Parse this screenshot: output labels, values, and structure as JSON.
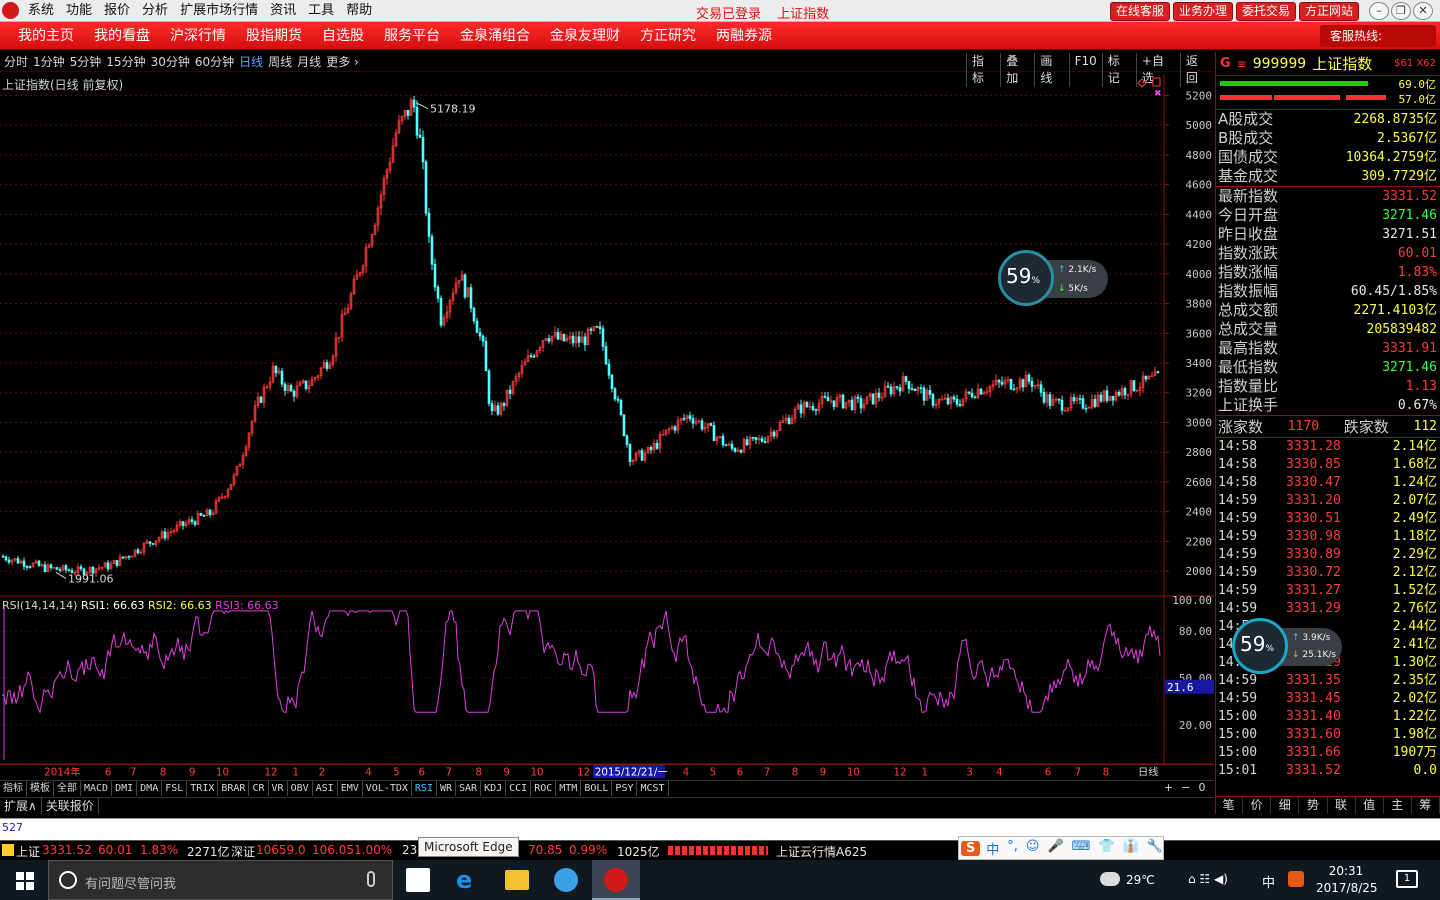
{
  "titlebar": {
    "menu": [
      "系统",
      "功能",
      "报价",
      "分析",
      "扩展市场行情",
      "资讯",
      "工具",
      "帮助"
    ],
    "status": "交易已登录",
    "context": "上证指数",
    "right_buttons": [
      "在线客服",
      "业务办理",
      "委托交易",
      "方正网站"
    ]
  },
  "navbar": {
    "items": [
      "我的主页",
      "我的看盘",
      "沪深行情",
      "股指期货",
      "自选股",
      "服务平台",
      "金泉涌组合",
      "金泉友理财",
      "方正研究",
      "两融券源"
    ],
    "hotline_label": "客服热线:",
    "hotline_number": "95571"
  },
  "periods": [
    "分时",
    "1分钟",
    "5分钟",
    "15分钟",
    "30分钟",
    "60分钟",
    "日线",
    "周线",
    "月线",
    "更多 ›"
  ],
  "selected_period": "日线",
  "chart_tools": [
    "指标",
    "叠加",
    "画线",
    "F10",
    "标记",
    "+自选",
    "返回"
  ],
  "chart_title": "上证指数(日线 前复权)",
  "rsi_header": {
    "name": "RSI(14,14,14)",
    "rsi1": "RSI1: 66.63",
    "rsi2": "RSI2: 66.63",
    "rsi3": "RSI3: 66.63"
  },
  "chart_data": {
    "type": "candlestick",
    "high_label": "5178.19",
    "low_label": "1991.06",
    "y_ticks": [
      "5200",
      "5000",
      "4800",
      "4600",
      "4400",
      "4200",
      "4000",
      "3800",
      "3600",
      "3400",
      "3200",
      "3000",
      "2800",
      "2600",
      "2400",
      "2200",
      "2000"
    ],
    "ylim": [
      1900,
      5250
    ],
    "rsi_ticks": [
      "100.00",
      "80.00",
      "50.00",
      "20.00"
    ],
    "rsi_current": "21.6",
    "date_axis": [
      "2014年",
      "6",
      "7",
      "8",
      "9",
      "10",
      "12",
      "1",
      "2",
      "4",
      "5",
      "6",
      "7",
      "8",
      "9",
      "10",
      "12",
      "2015/12/21/一",
      "4",
      "5",
      "6",
      "7",
      "8",
      "9",
      "10",
      "12",
      "1",
      "3",
      "4",
      "6",
      "7",
      "8"
    ],
    "date_axis_label": "日线",
    "colors": {
      "up": "#ff3c3c",
      "down": "#54ffff",
      "rsi": "#e040e0"
    }
  },
  "indicator_tabs": [
    "指标",
    "模板",
    "全部",
    "MACD",
    "DMI",
    "DMA",
    "FSL",
    "TRIX",
    "BRAR",
    "CR",
    "VR",
    "OBV",
    "ASI",
    "EMV",
    "VOL-TDX",
    "RSI",
    "WR",
    "SAR",
    "KDJ",
    "CCI",
    "ROC",
    "MTM",
    "BOLL",
    "PSY",
    "MCST"
  ],
  "selected_indicator": "RSI",
  "indicator_controls": [
    "+",
    "−",
    "0"
  ],
  "bottom_tabs": [
    "扩展∧",
    "关联报价"
  ],
  "quote": {
    "flag": "G",
    "code": "999999",
    "name": "上证指数",
    "tag": "$61 X62",
    "bar1_label": "69.0亿",
    "bar2_label": "57.0亿",
    "turnover_rows": [
      {
        "k": "A股成交",
        "v": "2268.8735亿"
      },
      {
        "k": "B股成交",
        "v": "2.5367亿"
      },
      {
        "k": "国债成交",
        "v": "10364.2759亿"
      },
      {
        "k": "基金成交",
        "v": "309.7729亿"
      }
    ],
    "index_rows": [
      {
        "k": "最新指数",
        "v": "3331.52",
        "c": "red"
      },
      {
        "k": "今日开盘",
        "v": "3271.46",
        "c": "grn"
      },
      {
        "k": "昨日收盘",
        "v": "3271.51",
        "c": "wht"
      },
      {
        "k": "指数涨跌",
        "v": "60.01",
        "c": "red"
      },
      {
        "k": "指数涨幅",
        "v": "1.83%",
        "c": "red"
      },
      {
        "k": "指数振幅",
        "v": "60.45/1.85%",
        "c": "wht"
      },
      {
        "k": "总成交额",
        "v": "2271.4103亿",
        "c": "yel"
      },
      {
        "k": "总成交量",
        "v": "205839482",
        "c": "yel"
      },
      {
        "k": "最高指数",
        "v": "3331.91",
        "c": "red"
      },
      {
        "k": "最低指数",
        "v": "3271.46",
        "c": "grn"
      },
      {
        "k": "指数量比",
        "v": "1.13",
        "c": "red"
      },
      {
        "k": "上证换手",
        "v": "0.67%",
        "c": "wht"
      }
    ],
    "breadth": {
      "up_label": "涨家数",
      "up": "1170",
      "down_label": "跌家数",
      "down": "112"
    },
    "ticks": [
      {
        "t": "14:58",
        "p": "3331.28",
        "a": "2.14亿"
      },
      {
        "t": "14:58",
        "p": "3330.85",
        "a": "1.68亿"
      },
      {
        "t": "14:58",
        "p": "3330.47",
        "a": "1.24亿"
      },
      {
        "t": "14:59",
        "p": "3331.20",
        "a": "2.07亿"
      },
      {
        "t": "14:59",
        "p": "3330.51",
        "a": "2.49亿"
      },
      {
        "t": "14:59",
        "p": "3330.98",
        "a": "1.18亿"
      },
      {
        "t": "14:59",
        "p": "3330.89",
        "a": "2.29亿"
      },
      {
        "t": "14:59",
        "p": "3330.72",
        "a": "2.12亿"
      },
      {
        "t": "14:59",
        "p": "3331.27",
        "a": "1.52亿"
      },
      {
        "t": "14:59",
        "p": "3331.29",
        "a": "2.76亿"
      },
      {
        "t": "14:59",
        "p": "",
        "a": "2.44亿"
      },
      {
        "t": "14:59",
        "p": "",
        "a": "2.41亿"
      },
      {
        "t": "14:59",
        "p": "3331.29",
        "a": "1.30亿"
      },
      {
        "t": "14:59",
        "p": "3331.35",
        "a": "2.35亿"
      },
      {
        "t": "14:59",
        "p": "3331.45",
        "a": "2.02亿"
      },
      {
        "t": "15:00",
        "p": "3331.40",
        "a": "1.22亿"
      },
      {
        "t": "15:00",
        "p": "3331.60",
        "a": "1.98亿"
      },
      {
        "t": "15:00",
        "p": "3331.66",
        "a": "1907万"
      },
      {
        "t": "15:01",
        "p": "3331.52",
        "a": "0.0"
      }
    ],
    "tabs": [
      "笔",
      "价",
      "细",
      "势",
      "联",
      "值",
      "主",
      "筹"
    ]
  },
  "gauge1": {
    "pct": "59",
    "unit": "%",
    "up": "2.1",
    "down": "5",
    "rate_unit": "K/s"
  },
  "gauge2": {
    "pct": "59",
    "unit": "%",
    "up": "3.9",
    "down": "25.1",
    "rate_unit": "K/s"
  },
  "scroll_text": "527",
  "statusbar": {
    "sh_label": "上证",
    "sh_val": "3331.52",
    "sh_chg": "60.01",
    "sh_pct": "1.83%",
    "sh_amt": "2271亿",
    "sz_label": "深证",
    "sz_val": "10659.0",
    "sz_chg": "106.05",
    "sz_pct": "1.00%",
    "sz_amt": "239",
    "c3_chg": "70.85",
    "c3_pct": "0.99%",
    "c3_amt": "1025亿",
    "cloud": "上证云行情A625"
  },
  "tooltip": "Microsoft Edge",
  "ime": [
    "中",
    "°,",
    "☺",
    "🎤",
    "⌨",
    "👕",
    "👔",
    "🔧"
  ],
  "taskbar": {
    "search_placeholder": "有问题尽管问我",
    "weather": "29℃",
    "ime_indicator": "中",
    "time": "20:31",
    "date": "2017/8/25",
    "notifications": "1"
  }
}
